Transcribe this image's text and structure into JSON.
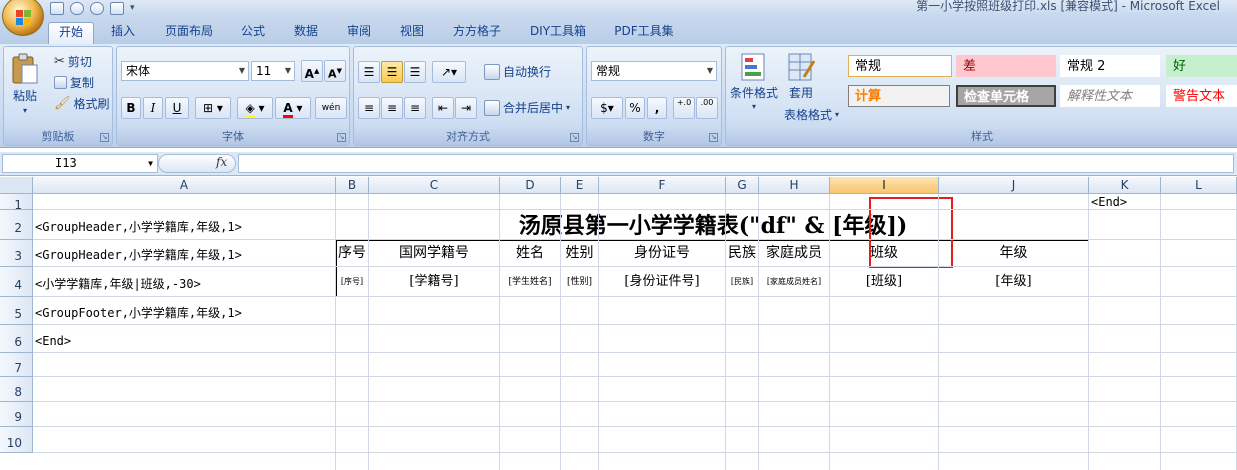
{
  "window": {
    "title": "第一小学按照班级打印.xls  [兼容模式] - Microsoft Excel"
  },
  "ribbon_tabs": [
    "开始",
    "插入",
    "页面布局",
    "公式",
    "数据",
    "审阅",
    "视图",
    "方方格子",
    "DIY工具箱",
    "PDF工具集"
  ],
  "clipboard": {
    "paste": "粘贴",
    "cut": "剪切",
    "copy": "复制",
    "format_painter": "格式刷",
    "label": "剪贴板"
  },
  "font": {
    "name": "宋体",
    "size": "11",
    "grow": "A",
    "shrink": "A",
    "bold": "B",
    "italic": "I",
    "underline": "U",
    "font_color_glyph": "A",
    "pinyin": "wén",
    "label": "字体"
  },
  "alignment": {
    "wrap": "自动换行",
    "merge": "合并后居中",
    "label": "对齐方式"
  },
  "number": {
    "format": "常规",
    "percent": "%",
    "comma": ",",
    "inc_decimal": "+.0",
    "dec_decimal": ".00",
    "label": "数字"
  },
  "styles": {
    "conditional_formatting": "条件格式",
    "format_as_table_1": "套用",
    "format_as_table_2": "表格格式",
    "cells": [
      {
        "text": "常规",
        "bg": "#ffffff",
        "fg": "#000000"
      },
      {
        "text": "差",
        "bg": "#ffc7ce",
        "fg": "#9c0006"
      },
      {
        "text": "常规 2",
        "bg": "#ffffff",
        "fg": "#000000"
      },
      {
        "text": "好",
        "bg": "#c6efce",
        "fg": "#006100"
      },
      {
        "text": "计算",
        "bg": "#f2f2f2",
        "fg": "#fa7d00"
      },
      {
        "text": "检查单元格",
        "bg": "#a5a5a5",
        "fg": "#ffffff"
      },
      {
        "text": "解释性文本",
        "bg": "#ffffff",
        "fg": "#7f7f7f"
      },
      {
        "text": "警告文本",
        "bg": "#ffffff",
        "fg": "#ff0000"
      }
    ],
    "label": "样式"
  },
  "formula_bar": {
    "name_box": "I13",
    "fx": "fx",
    "formula": ""
  },
  "columns": [
    "A",
    "B",
    "C",
    "D",
    "E",
    "F",
    "G",
    "H",
    "I",
    "J",
    "K",
    "L"
  ],
  "selected_column": "I",
  "rows": [
    "1",
    "2",
    "3",
    "4",
    "5",
    "6",
    "7",
    "8",
    "9",
    "10"
  ],
  "cells": {
    "K1": "<End>",
    "A2": "<GroupHeader,小学学籍库,年级,1>",
    "A3": "<GroupHeader,小学学籍库,年级,1>",
    "A4": "<小学学籍库,年级|班级,-30>",
    "A5": "<GroupFooter,小学学籍库,年级,1>",
    "A6": "<End>"
  },
  "title": "汤原县第一小学学籍表(\"df\" & [年级])",
  "headers": [
    "序号",
    "国网学籍号",
    "姓名",
    "姓别",
    "身份证号",
    "民族",
    "家庭成员",
    "班级",
    "年级"
  ],
  "field_row": [
    "[序号]",
    "[学籍号]",
    "[学生姓名]",
    "[性别]",
    "[身份证件号]",
    "[民族]",
    "[家庭成员姓名]",
    "[班级]",
    "[年级]"
  ]
}
